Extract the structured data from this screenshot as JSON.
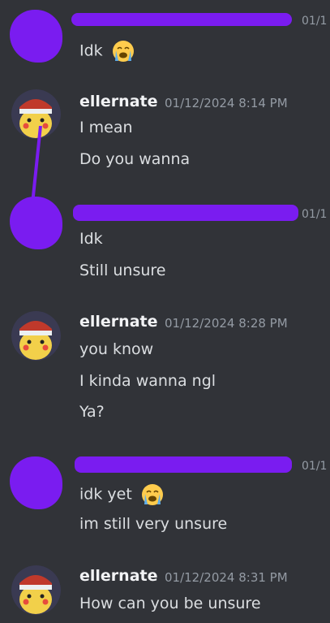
{
  "messages": [
    {
      "author": "",
      "time": "01/1",
      "censored": true,
      "lines": [
        "Idk"
      ],
      "emoji_after": [
        0
      ]
    },
    {
      "author": "ellernate",
      "time": "01/12/2024 8:14 PM",
      "censored": false,
      "lines": [
        "I mean",
        "Do you wanna"
      ]
    },
    {
      "author": "",
      "time": "01/1",
      "censored": true,
      "lines": [
        "Idk",
        "Still unsure"
      ]
    },
    {
      "author": "ellernate",
      "time": "01/12/2024 8:28 PM",
      "censored": false,
      "lines": [
        "you know",
        "I kinda wanna ngl",
        "Ya?"
      ]
    },
    {
      "author": "",
      "time": "01/1",
      "censored": true,
      "lines": [
        "idk yet",
        "im still very unsure"
      ],
      "emoji_after": [
        0
      ]
    },
    {
      "author": "ellernate",
      "time": "01/12/2024 8:31 PM",
      "censored": false,
      "lines": [
        "How can you be unsure"
      ]
    }
  ],
  "icons": {
    "crying_emoji": "loudly-crying-face-icon",
    "avatar": "pikachu-avatar-icon"
  },
  "colors": {
    "background": "#313338",
    "redaction": "#7a1cf0",
    "text": "#dbdee1",
    "timestamp": "#949ba4"
  }
}
